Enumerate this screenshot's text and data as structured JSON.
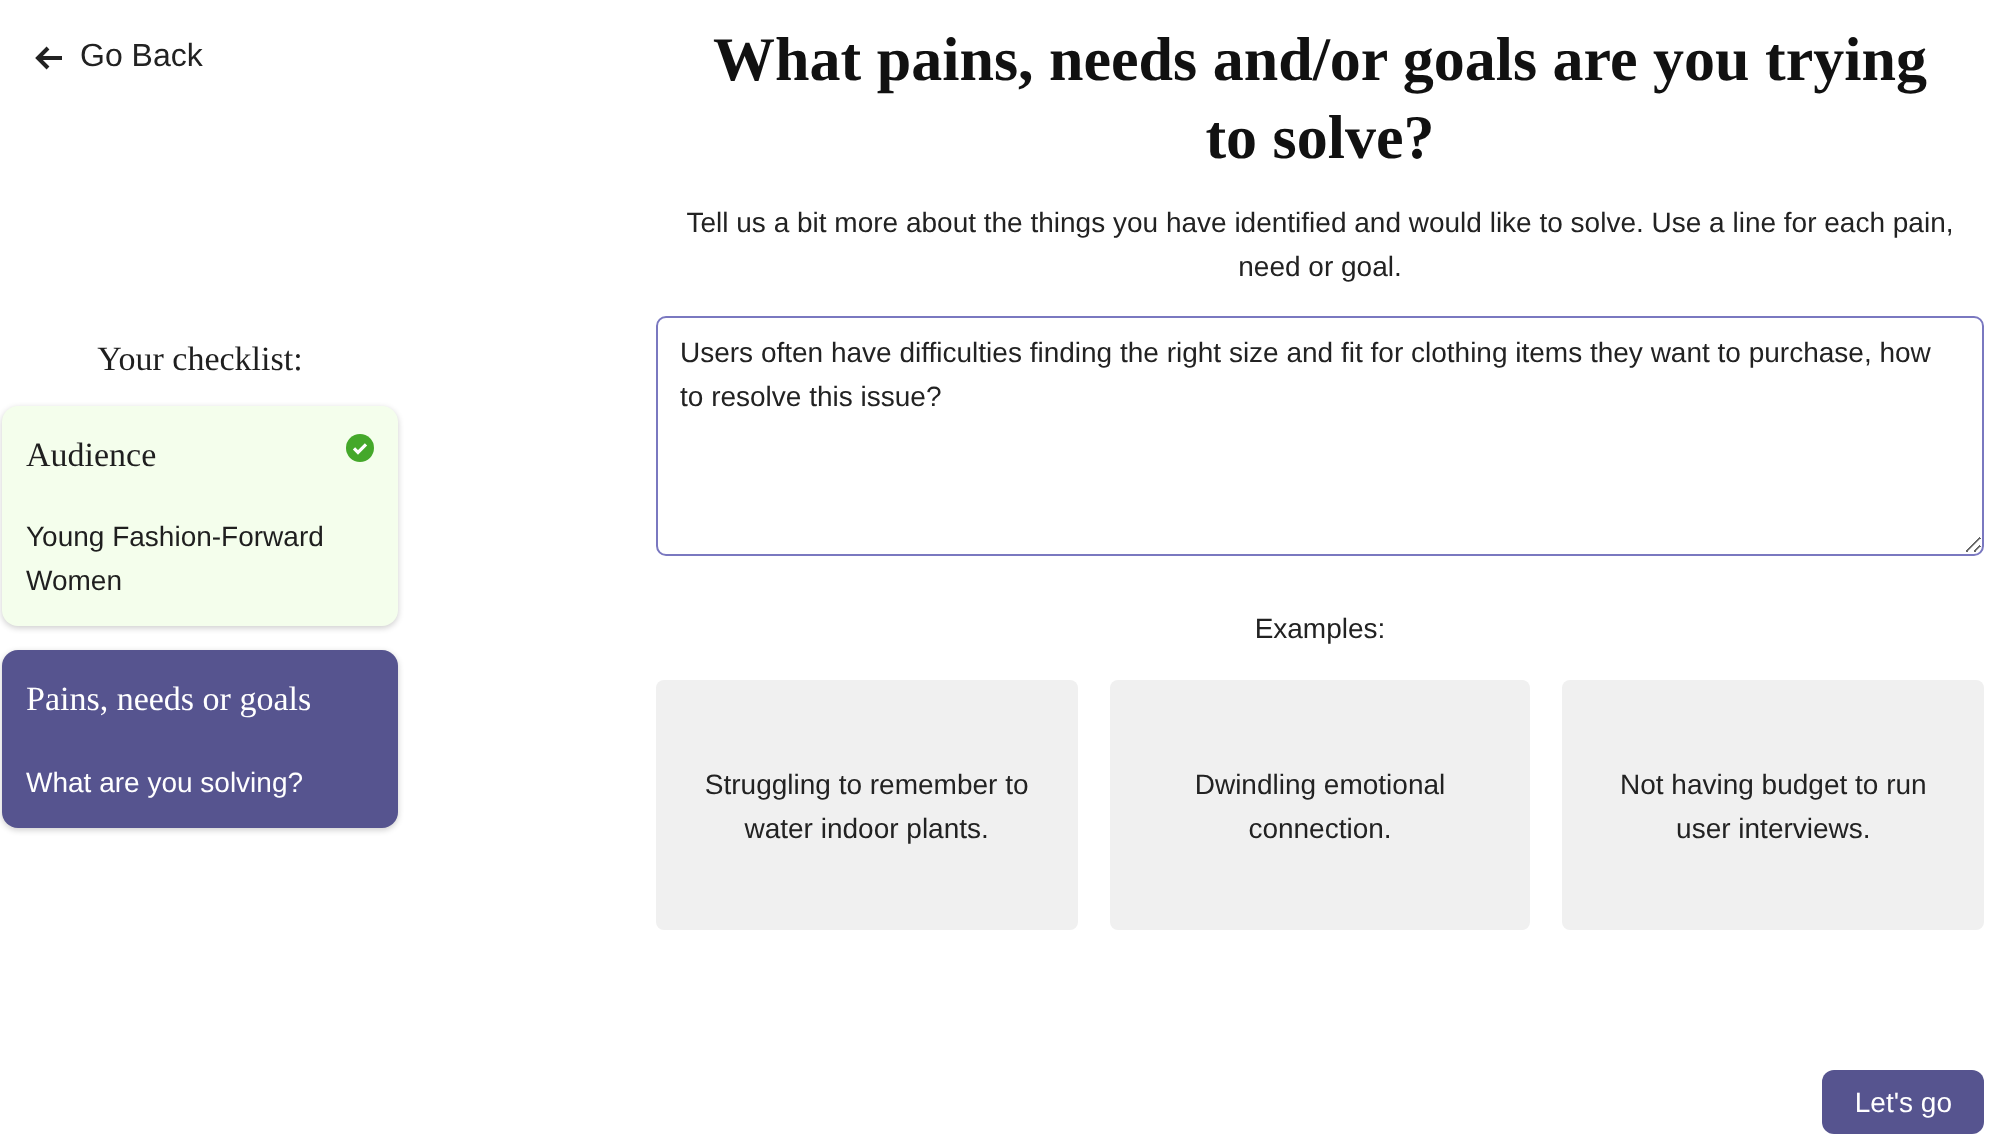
{
  "back_link": {
    "label": "Go Back"
  },
  "checklist": {
    "title": "Your checklist:",
    "items": [
      {
        "title": "Audience",
        "subtitle": "Young Fashion-Forward Women",
        "done": true,
        "selected": false
      },
      {
        "title": "Pains, needs or goals",
        "subtitle": "What are you solving?",
        "done": false,
        "selected": true
      }
    ]
  },
  "heading": "What pains, needs and/or goals are you trying to solve?",
  "description": "Tell us a bit more about the things you have identified and would like to solve. Use a line for each pain, need or goal.",
  "answer": {
    "value": "Users often have difficulties finding the right size and fit for clothing items they want to purchase, how to resolve this issue?"
  },
  "examples": {
    "title": "Examples:",
    "items": [
      "Struggling to remember to water indoor plants.",
      "Dwindling emotional connection.",
      "Not having budget to run user interviews."
    ]
  },
  "submit_button": "Let's go"
}
